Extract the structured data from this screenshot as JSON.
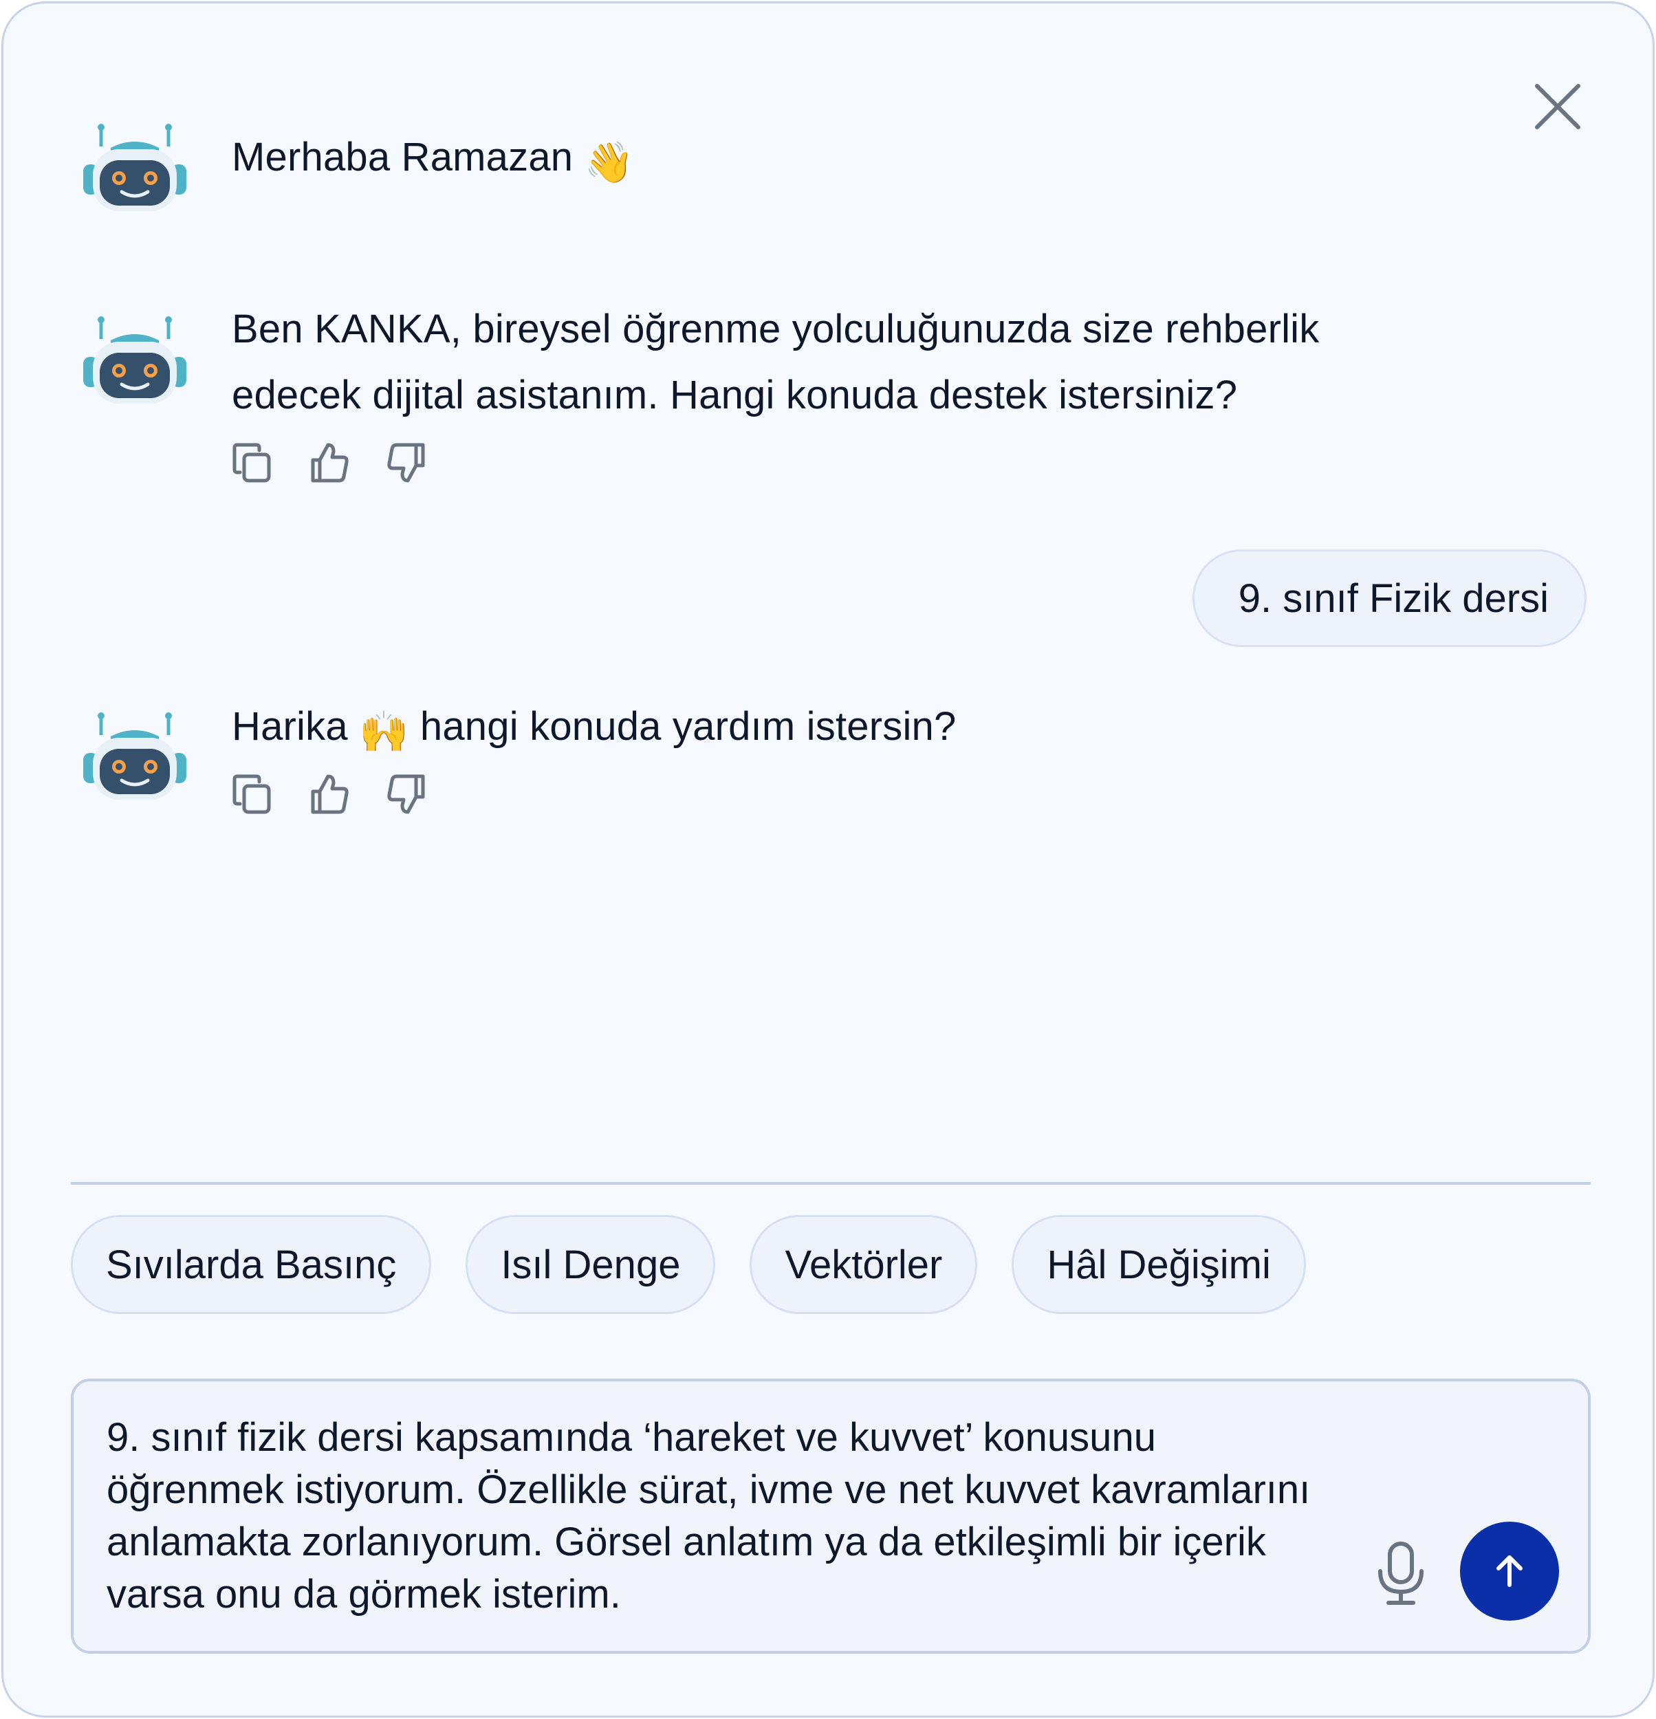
{
  "colors": {
    "panel_bg": "#f6f9fd",
    "border": "#c7d3ea",
    "chip_bg": "#eef3fb",
    "send_button": "#0a2fa8",
    "icon_gray": "#6b7280"
  },
  "header": {
    "close_icon": "close-icon"
  },
  "messages": [
    {
      "role": "bot",
      "avatar": "robot-avatar",
      "text": "Merhaba Ramazan",
      "emoji": "👋"
    },
    {
      "role": "bot",
      "avatar": "robot-avatar",
      "line1": "Ben KANKA, bireysel öğrenme yolculuğunuzda size rehberlik",
      "line2": "edecek dijital asistanım. Hangi konuda destek istersiniz?",
      "actions": [
        "copy-icon",
        "thumbs-up-icon",
        "thumbs-down-icon"
      ]
    },
    {
      "role": "user",
      "text": "9. sınıf Fizik dersi"
    },
    {
      "role": "bot",
      "avatar": "robot-avatar",
      "text_before": "Harika",
      "emoji": "🙌",
      "text_after": "hangi konuda yardım istersin?",
      "actions": [
        "copy-icon",
        "thumbs-up-icon",
        "thumbs-down-icon"
      ]
    }
  ],
  "suggestions": [
    "Sıvılarda Basınç",
    "Isıl Denge",
    "Vektörler",
    "Hâl Değişimi"
  ],
  "composer": {
    "value": "9. sınıf fizik dersi kapsamında ‘hareket ve kuvvet’ konusunu öğrenmek istiyorum. Özellikle sürat, ivme ve net kuvvet kavramlarını anlamakta zorlanıyorum. Görsel anlatım ya da etkileşimli bir içerik varsa onu da görmek isterim.",
    "mic_icon": "microphone-icon",
    "send_icon": "arrow-up-icon"
  }
}
